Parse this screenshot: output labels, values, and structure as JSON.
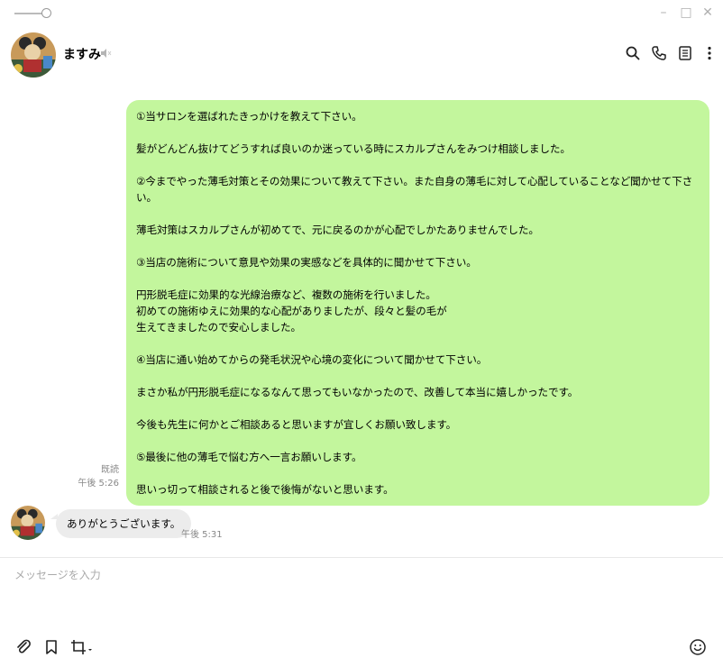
{
  "window": {
    "minimize_glyph": "–",
    "maximize_glyph": "□",
    "close_glyph": "✕"
  },
  "header": {
    "contact_name": "ますみ"
  },
  "messages": {
    "me": {
      "text": "①当サロンを選ばれたきっかけを教えて下さい。\n\n髪がどんどん抜けてどうすれば良いのか迷っている時にスカルプさんをみつけ相談しました。\n\n②今までやった薄毛対策とその効果について教えて下さい。また自身の薄毛に対して心配していることなど聞かせて下さい。\n\n薄毛対策はスカルプさんが初めてで、元に戻るのかが心配でしかたありませんでした。\n\n③当店の施術について意見や効果の実感などを具体的に聞かせて下さい。\n\n円形脱毛症に効果的な光線治療など、複数の施術を行いました。\n初めての施術ゆえに効果的な心配がありましたが、段々と髪の毛が\n生えてきましたので安心しました。\n\n④当店に通い始めてからの発毛状況や心境の変化について聞かせて下さい。\n\nまさか私が円形脱毛症になるなんて思ってもいなかったので、改善して本当に嬉しかったです。\n\n今後も先生に何かとご相談あると思いますが宜しくお願い致します。\n\n⑤最後に他の薄毛で悩む方へ一言お願いします。\n\n思いっ切って相談されると後で後悔がないと思います。",
      "read_label": "既読",
      "time": "午後 5:26"
    },
    "them": {
      "text": "ありがとうございます。",
      "time": "午後 5:31"
    }
  },
  "composer": {
    "placeholder": "メッセージを入力"
  },
  "icons": {
    "search": "search-icon",
    "call": "phone-icon",
    "notes": "notes-icon",
    "more": "more-vertical-icon",
    "mute": "speaker-muted-icon",
    "attach": "paperclip-icon",
    "bookmark": "bookmark-icon",
    "crop": "crop-icon",
    "emoji": "smiley-icon"
  },
  "colors": {
    "my_bubble": "#c3f69d",
    "their_bubble": "#ececec",
    "meta_text": "#888888"
  }
}
